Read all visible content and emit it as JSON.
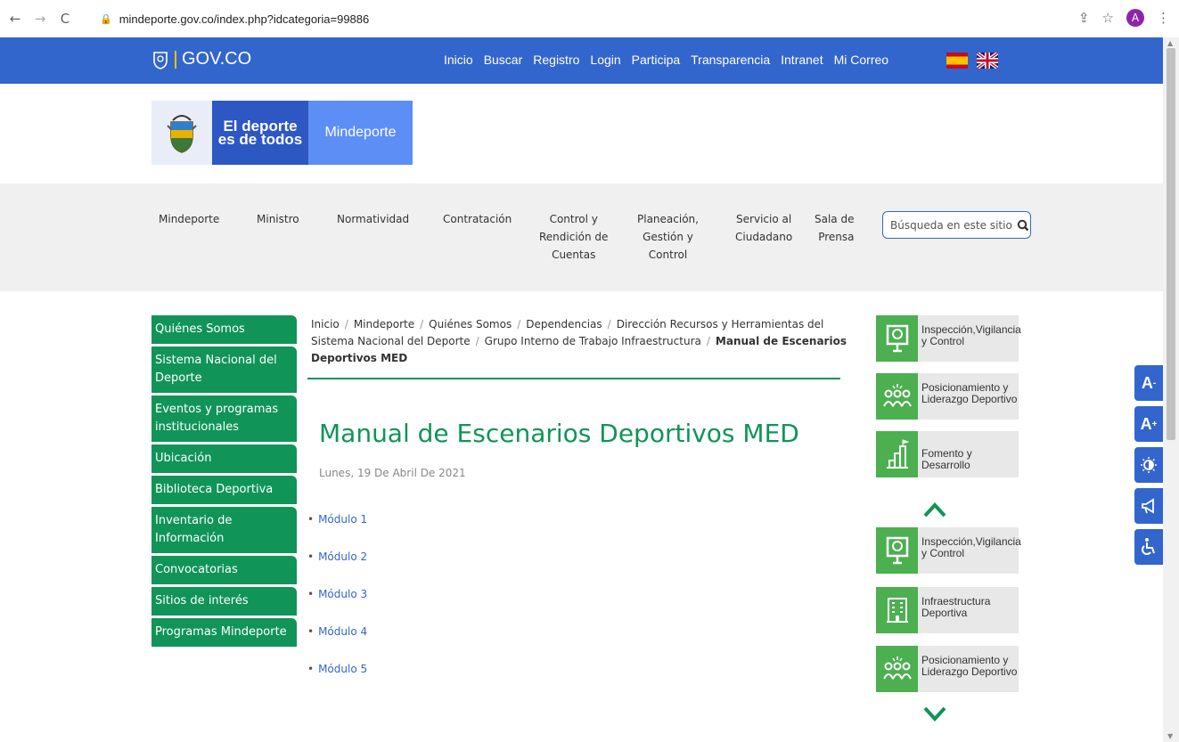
{
  "browser": {
    "url": "mindeporte.gov.co/index.php?idcategoria=99886",
    "avatar_letter": "A"
  },
  "govbar": {
    "logo_text": "GOV.CO",
    "nav": [
      "Inicio",
      "Buscar",
      "Registro",
      "Login",
      "Participa",
      "Transparencia",
      "Intranet",
      "Mi Correo"
    ],
    "color": "#3366cc"
  },
  "brand": {
    "line1": "El deporte",
    "line2": "es de todos",
    "name": "Mindeporte"
  },
  "main_nav": {
    "items": [
      {
        "line1": "Mindeporte",
        "line2": "",
        "line3": ""
      },
      {
        "line1": "Ministro",
        "line2": "",
        "line3": ""
      },
      {
        "line1": "Normatividad",
        "line2": "",
        "line3": ""
      },
      {
        "line1": "Contratación",
        "line2": "",
        "line3": ""
      },
      {
        "line1": "Control y",
        "line2": "Rendición de",
        "line3": "Cuentas"
      },
      {
        "line1": "Planeación,",
        "line2": "Gestión y",
        "line3": "Control"
      },
      {
        "line1": "Servicio al",
        "line2": "Ciudadano",
        "line3": ""
      },
      {
        "line1": "Sala de",
        "line2": "Prensa",
        "line3": ""
      }
    ],
    "search_placeholder": "Búsqueda en este sitio"
  },
  "sidebar": {
    "color": "#109458",
    "items": [
      {
        "line1": "Quiénes Somos",
        "line2": ""
      },
      {
        "line1": "Sistema Nacional del",
        "line2": "Deporte"
      },
      {
        "line1": "Eventos y programas",
        "line2": "institucionales"
      },
      {
        "line1": "Ubicación",
        "line2": ""
      },
      {
        "line1": "Biblioteca Deportiva",
        "line2": ""
      },
      {
        "line1": "Inventario de",
        "line2": "Información"
      },
      {
        "line1": "Convocatorias",
        "line2": ""
      },
      {
        "line1": "Sitios de interés",
        "line2": ""
      },
      {
        "line1": "Programas Mindeporte",
        "line2": ""
      }
    ]
  },
  "breadcrumb": {
    "items": [
      "Inicio",
      "Mindeporte",
      "Quiénes Somos",
      "Dependencias",
      "Dirección Recursos y Herramientas del Sistema Nacional del Deporte",
      "Grupo Interno de Trabajo Infraestructura"
    ],
    "current": "Manual de Escenarios Deportivos MED"
  },
  "article": {
    "title": "Manual de Escenarios Deportivos MED",
    "date": "Lunes, 19 De Abril De 2021",
    "modules": [
      "Módulo 1",
      "Módulo 2",
      "Módulo 3",
      "Módulo 4",
      "Módulo 5"
    ]
  },
  "carousel": {
    "cards": [
      {
        "line1": "Inspección,Vigilancia",
        "line2": "y Control",
        "icon": "inspection-icon"
      },
      {
        "line1": "Posicionamiento y",
        "line2": "Liderazgo Deportivo",
        "icon": "people-icon"
      },
      {
        "line1": "Fomento y Desarrollo",
        "line2": "",
        "icon": "podium-icon"
      },
      {
        "line1": "Inspección,Vigilancia",
        "line2": "y Control",
        "icon": "inspection-icon"
      },
      {
        "line1": "Infraestructura",
        "line2": "Deportiva",
        "icon": "building-icon"
      },
      {
        "line1": "Posicionamiento y",
        "line2": "Liderazgo Deportivo",
        "icon": "people-icon"
      }
    ]
  },
  "accessibility": {
    "decrease_label": "A",
    "increase_label": "A",
    "minus": "-",
    "plus": "+"
  }
}
